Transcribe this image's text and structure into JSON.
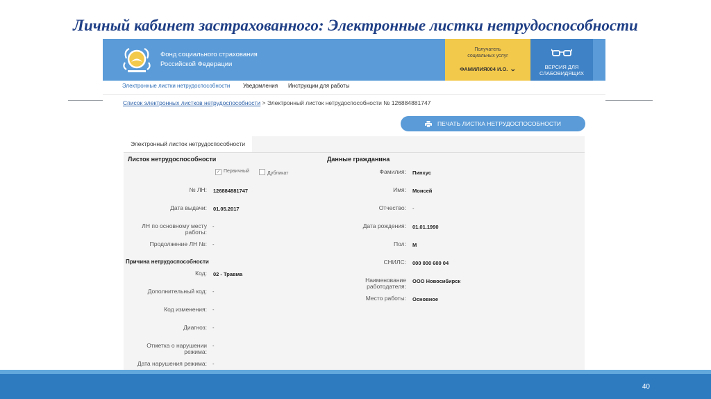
{
  "slide": {
    "title": "Личный кабинет застрахованного: Электронные листки нетрудоспособности",
    "page_number": "40"
  },
  "header": {
    "org_line1": "Фонд социального страхования",
    "org_line2": "Российской Федерации",
    "user_caption_line1": "Получатель",
    "user_caption_line2": "социальных услуг",
    "user_name": "ФАМИЛИЯ004 И.О.",
    "vision_line1": "ВЕРСИЯ ДЛЯ",
    "vision_line2": "СЛАБОВИДЯЩИХ"
  },
  "nav": {
    "tabs": [
      "Электронные листки нетрудоспособности",
      "Уведомления",
      "Инструкции для работы"
    ]
  },
  "breadcrumb": {
    "link": "Список электронных листков нетрудоспособности",
    "current": " > Электронный листок нетрудоспособности № 126884881747"
  },
  "print_button": "ПЕЧАТЬ ЛИСТКА НЕТРУДОСПОСОБНОСТИ",
  "card": {
    "tab": "Электронный листок нетрудоспособности",
    "left": {
      "title": "Листок нетрудоспособности",
      "check_primary": "Первичный",
      "check_duplicate": "Дубликат",
      "fields": [
        {
          "label": "№ ЛН:",
          "value": "126884881747"
        },
        {
          "label": "Дата выдачи:",
          "value": "01.05.2017"
        },
        {
          "label_line1": "ЛН по основному месту",
          "label_line2": "работы:",
          "value": "-"
        },
        {
          "label": "Продолжение ЛН №:",
          "value": "-"
        }
      ],
      "reason_title": "Причина нетрудоспособности",
      "reason_fields": [
        {
          "label": "Код:",
          "value": "02 - Травма"
        },
        {
          "label": "Дополнительный код:",
          "value": "-"
        },
        {
          "label": "Код изменения:",
          "value": "-"
        },
        {
          "label": "Диагноз:",
          "value": "-"
        },
        {
          "label_line1": "Отметка о нарушении",
          "label_line2": "режима:",
          "value": "-"
        },
        {
          "label": "Дата нарушения режима:",
          "value": "-"
        }
      ]
    },
    "right": {
      "title": "Данные гражданина",
      "fields": [
        {
          "label": "Фамилия:",
          "value": "Пинхус"
        },
        {
          "label": "Имя:",
          "value": "Моисей"
        },
        {
          "label": "Отчество:",
          "value": "-"
        },
        {
          "label": "Дата рождения:",
          "value": "01.01.1990"
        },
        {
          "label": "Пол:",
          "value": "М"
        },
        {
          "label": "СНИЛС:",
          "value": "000 000 600 04"
        },
        {
          "label_line1": "Наименование",
          "label_line2": "работодателя:",
          "value": "ООО Новосибирск"
        },
        {
          "label": "Место работы:",
          "value": "Основное"
        }
      ]
    }
  }
}
